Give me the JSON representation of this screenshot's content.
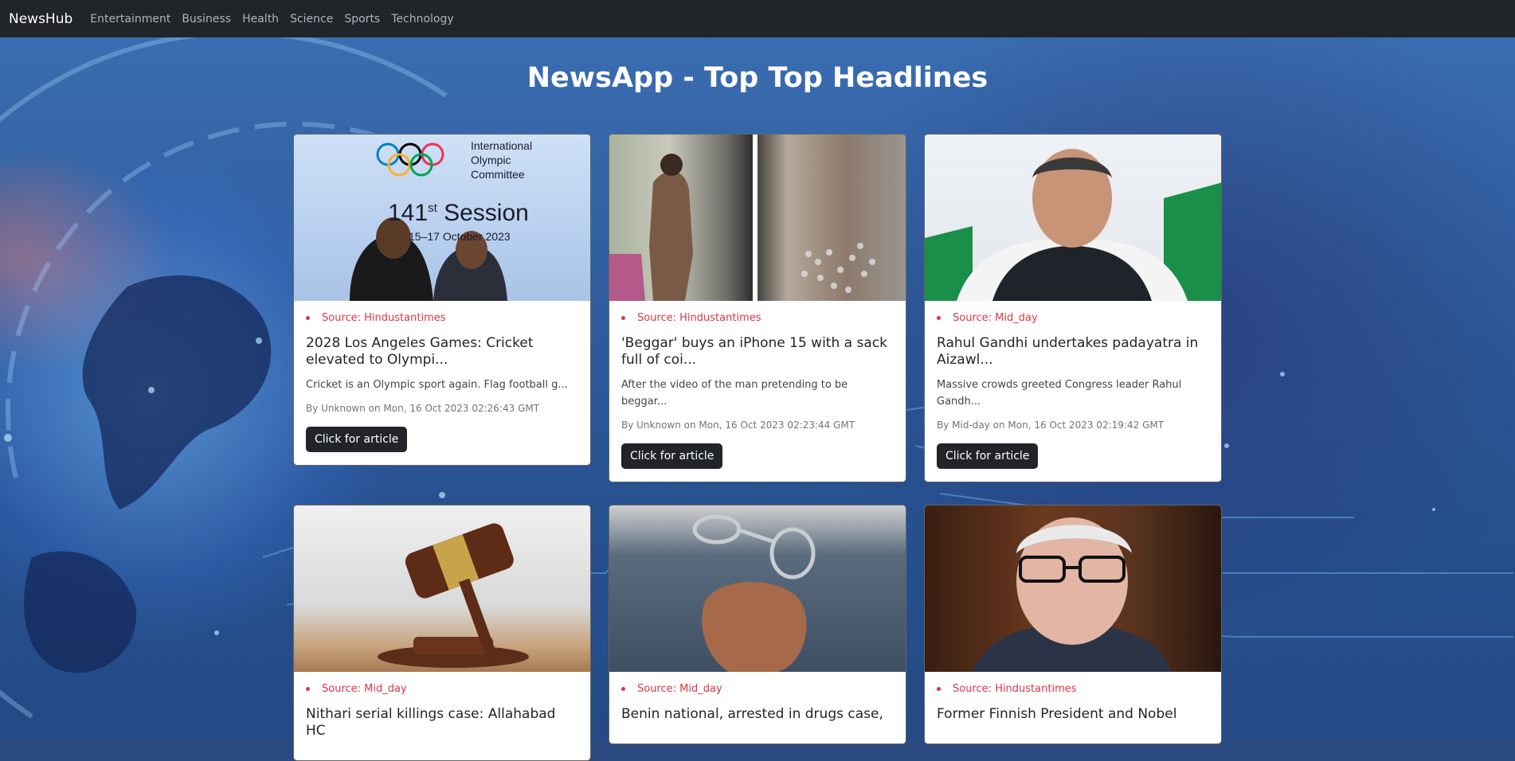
{
  "navbar": {
    "brand": "NewsHub",
    "links": [
      "Entertainment",
      "Business",
      "Health",
      "Science",
      "Sports",
      "Technology"
    ]
  },
  "page_title": "NewsApp - Top Top Headlines",
  "button_label": "Click for article",
  "articles": [
    {
      "source": "Source: Hindustantimes",
      "title": "2028 Los Angeles Games: Cricket elevated to Olympi...",
      "description": "Cricket is an Olympic sport again. Flag football g...",
      "meta": "By Unknown on Mon, 16 Oct 2023 02:26:43 GMT",
      "image_text": {
        "line1": "International",
        "line2": "Olympic",
        "line3": "Committee",
        "session_number": "141",
        "session_suffix": "st",
        "session_word": "Session",
        "dates": "15–17 October 2023"
      }
    },
    {
      "source": "Source: Hindustantimes",
      "title": "'Beggar' buys an iPhone 15 with a sack full of coi...",
      "description": "After the video of the man pretending to be beggar...",
      "meta": "By Unknown on Mon, 16 Oct 2023 02:23:44 GMT"
    },
    {
      "source": "Source: Mid_day",
      "title": "Rahul Gandhi undertakes padayatra in Aizawl...",
      "description": "Massive crowds greeted Congress leader Rahul Gandh...",
      "meta": "By Mid-day on Mon, 16 Oct 2023 02:19:42 GMT"
    },
    {
      "source": "Source: Mid_day",
      "title": "Nithari serial killings case: Allahabad HC"
    },
    {
      "source": "Source: Mid_day",
      "title": "Benin national, arrested in drugs case,"
    },
    {
      "source": "Source: Hindustantimes",
      "title": "Former Finnish President and Nobel"
    }
  ],
  "colors": {
    "navbar": "#212529",
    "source": "#dc3545",
    "button": "#212529"
  }
}
